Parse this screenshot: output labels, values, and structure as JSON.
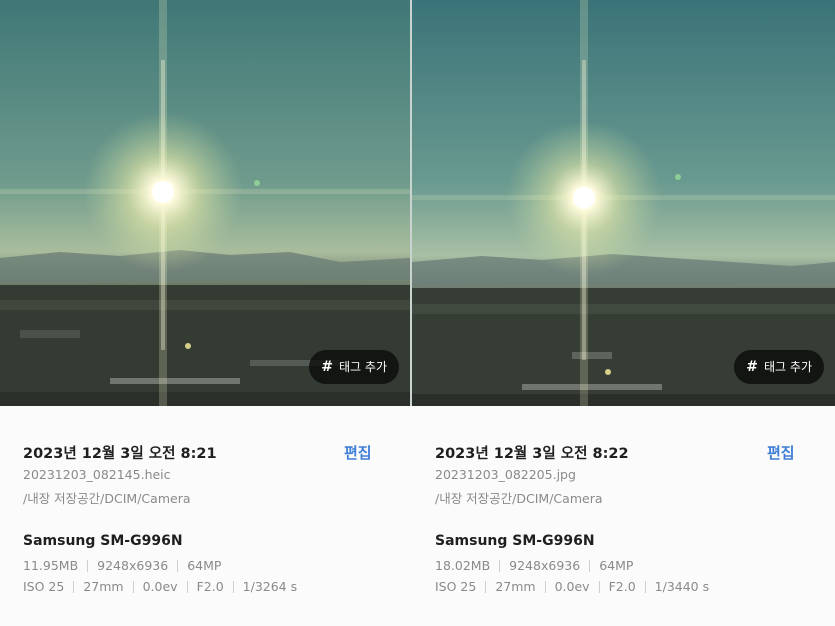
{
  "panels": [
    {
      "tag_button": {
        "hash": "#",
        "label": "태그 추가"
      },
      "date": "2023년 12월 3일 오전 8:21",
      "edit_label": "편집",
      "filename": "20231203_082145.heic",
      "path": "/내장 저장공간/DCIM/Camera",
      "device": "Samsung SM-G996N",
      "size": "11.95MB",
      "resolution": "9248x6936",
      "megapixels": "64MP",
      "iso": "ISO 25",
      "focal": "27mm",
      "ev": "0.0ev",
      "aperture": "F2.0",
      "shutter": "1/3264 s"
    },
    {
      "tag_button": {
        "hash": "#",
        "label": "태그 추가"
      },
      "date": "2023년 12월 3일 오전 8:22",
      "edit_label": "편집",
      "filename": "20231203_082205.jpg",
      "path": "/내장 저장공간/DCIM/Camera",
      "device": "Samsung SM-G996N",
      "size": "18.02MB",
      "resolution": "9248x6936",
      "megapixels": "64MP",
      "iso": "ISO 25",
      "focal": "27mm",
      "ev": "0.0ev",
      "aperture": "F2.0",
      "shutter": "1/3440 s"
    }
  ],
  "colors": {
    "accent": "#3f7fd6",
    "muted_text": "#8a8a8a",
    "primary_text": "#1f1f1f",
    "sky": "#4a7f80"
  }
}
